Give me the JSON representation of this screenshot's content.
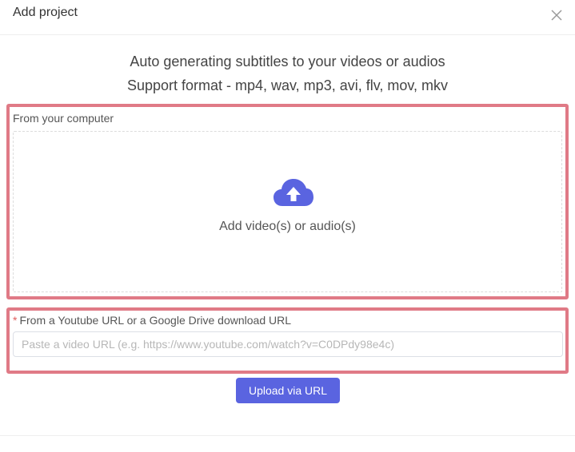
{
  "dialog": {
    "title": "Add project"
  },
  "intro": {
    "line1": "Auto generating subtitles to your videos or audios",
    "line2": "Support format - mp4, wav, mp3, avi, flv, mov, mkv"
  },
  "file_section": {
    "label": "From your computer",
    "drop_text": "Add video(s) or audio(s)",
    "icon": "cloud-upload-icon"
  },
  "url_section": {
    "required_mark": "*",
    "label": "From a Youtube URL or a Google Drive download URL",
    "placeholder": "Paste a video URL (e.g. https://www.youtube.com/watch?v=C0DPdy98e4c)",
    "value": ""
  },
  "actions": {
    "upload_label": "Upload via URL"
  },
  "colors": {
    "accent": "#5a64e0",
    "highlight_border": "#e07a86"
  }
}
